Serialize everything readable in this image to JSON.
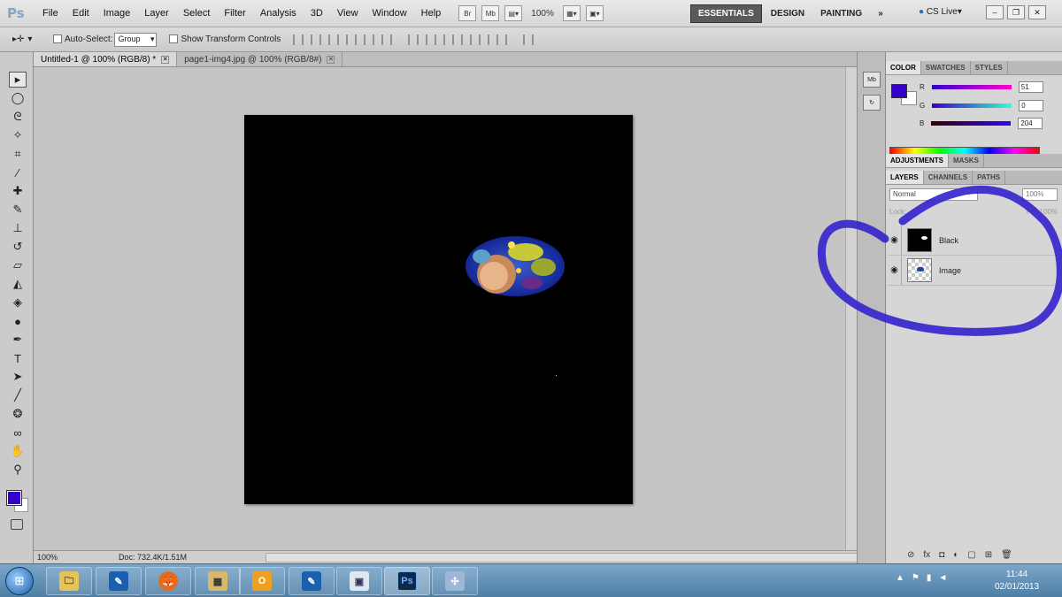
{
  "app": {
    "logo": "Ps"
  },
  "menu": {
    "items": [
      "File",
      "Edit",
      "Image",
      "Layer",
      "Select",
      "Filter",
      "Analysis",
      "3D",
      "View",
      "Window",
      "Help"
    ],
    "bridge": "Br",
    "minibridge": "Mb",
    "zoom": "100%",
    "workspaces": [
      "ESSENTIALS",
      "DESIGN",
      "PAINTING"
    ],
    "more": "»",
    "cslive": "CS Live",
    "window_controls": [
      "–",
      "❐",
      "✕"
    ]
  },
  "options": {
    "auto_select_label": "Auto-Select:",
    "auto_select_value": "Group",
    "transform_label": "Show Transform Controls"
  },
  "tabs": [
    {
      "label": "Untitled-1 @ 100% (RGB/8) *",
      "close": "✕"
    },
    {
      "label": "page1-img4.jpg @ 100% (RGB/8#)",
      "close": "✕"
    }
  ],
  "status": {
    "zoom": "100%",
    "doc": "Doc: 732.4K/1.51M"
  },
  "panels": {
    "color_tabs": [
      "COLOR",
      "SWATCHES",
      "STYLES"
    ],
    "color": {
      "r_label": "R",
      "r_value": "51",
      "g_label": "G",
      "g_value": "0",
      "b_label": "B",
      "b_value": "204",
      "fg_color": "#3300cc"
    },
    "adj_tabs": [
      "ADJUSTMENTS",
      "MASKS"
    ],
    "layers_tabs": [
      "LAYERS",
      "CHANNELS",
      "PATHS"
    ],
    "blend_mode": "Normal",
    "opacity": "100%",
    "fill": "Fill: 100%",
    "lock": "Lock:",
    "layers": [
      {
        "name": "Black"
      },
      {
        "name": "Image"
      }
    ],
    "footer_icons": [
      "⊘",
      "fx",
      "◘",
      "◐",
      "▢",
      "⊞",
      "🗑"
    ]
  },
  "dock": {
    "btn1": "Mb"
  },
  "taskbar": {
    "apps": [
      "🗀",
      "✎",
      "🦊",
      "▦",
      "O",
      "✎",
      "▣",
      "Ps",
      "✣"
    ],
    "tray": [
      "▲",
      "⚑",
      "▮",
      "◄"
    ],
    "time": "11:44",
    "date": "02/01/2013"
  },
  "annotation": {
    "color": "#3322cc"
  }
}
